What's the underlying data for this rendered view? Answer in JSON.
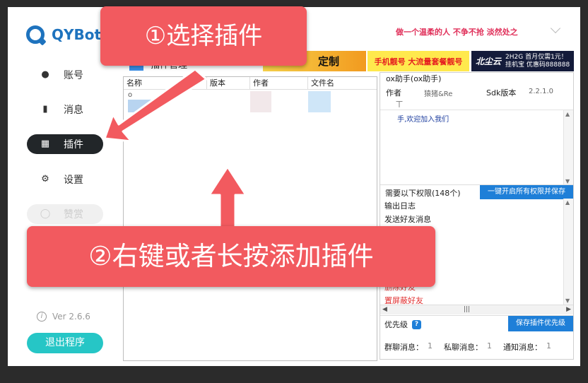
{
  "app": {
    "name": "QYBot",
    "slogan": "做一个温柔的人 不争不抢 淡然处之",
    "version": "Ver 2.6.6"
  },
  "sidebar": {
    "items": [
      {
        "label": "账号",
        "icon": "user-icon",
        "state": "normal"
      },
      {
        "label": "消息",
        "icon": "chat-icon",
        "state": "normal"
      },
      {
        "label": "插件",
        "icon": "grid-icon",
        "state": "active"
      },
      {
        "label": "设置",
        "icon": "gear-icon",
        "state": "normal"
      },
      {
        "label": "赞赏",
        "icon": "coin-icon",
        "state": "disabled"
      }
    ],
    "exit_label": "退出程序"
  },
  "banners": {
    "b1": "定制",
    "b2": "手机靓号 大流量套餐靓号",
    "b3_brand": "北尘云",
    "b3_line1": "2H2G 首月仅需1元！",
    "b3_line2": "挂机宝 优惠码888888"
  },
  "plugins": {
    "title": "插件管理",
    "columns": [
      "名称",
      "版本",
      "作者",
      "文件名"
    ],
    "first_row_mark": "o"
  },
  "detail": {
    "name": "ox助手(ox助手)",
    "author_label": "作者",
    "author_value": "猿猪&Re",
    "sdk_label": "Sdk版本",
    "sdk_value": "2.2.1.0",
    "bar_mark": "丅",
    "description": "手,欢迎加入我们",
    "perm_label": "需要以下权限(148个)",
    "perm_button": "一键开启所有权限并保存",
    "permissions": [
      "输出日志",
      "发送好友消息"
    ],
    "permissions_partial": [
      "删除好友",
      "置屏蔽好友"
    ],
    "priority_label": "优先级",
    "priority_help": "?",
    "priority_button": "保存插件优先级",
    "counts": [
      {
        "label": "群聊消息：",
        "value": "1"
      },
      {
        "label": "私聊消息：",
        "value": "1"
      },
      {
        "label": "通知消息：",
        "value": "1"
      }
    ]
  },
  "overlays": {
    "step1": "①选择插件",
    "step2": "②右键或者长按添加插件"
  },
  "colors": {
    "brand": "#1e73be",
    "accent": "#26c6c6",
    "overlay": "#f25a5f",
    "primary_btn": "#1e7fd8"
  }
}
